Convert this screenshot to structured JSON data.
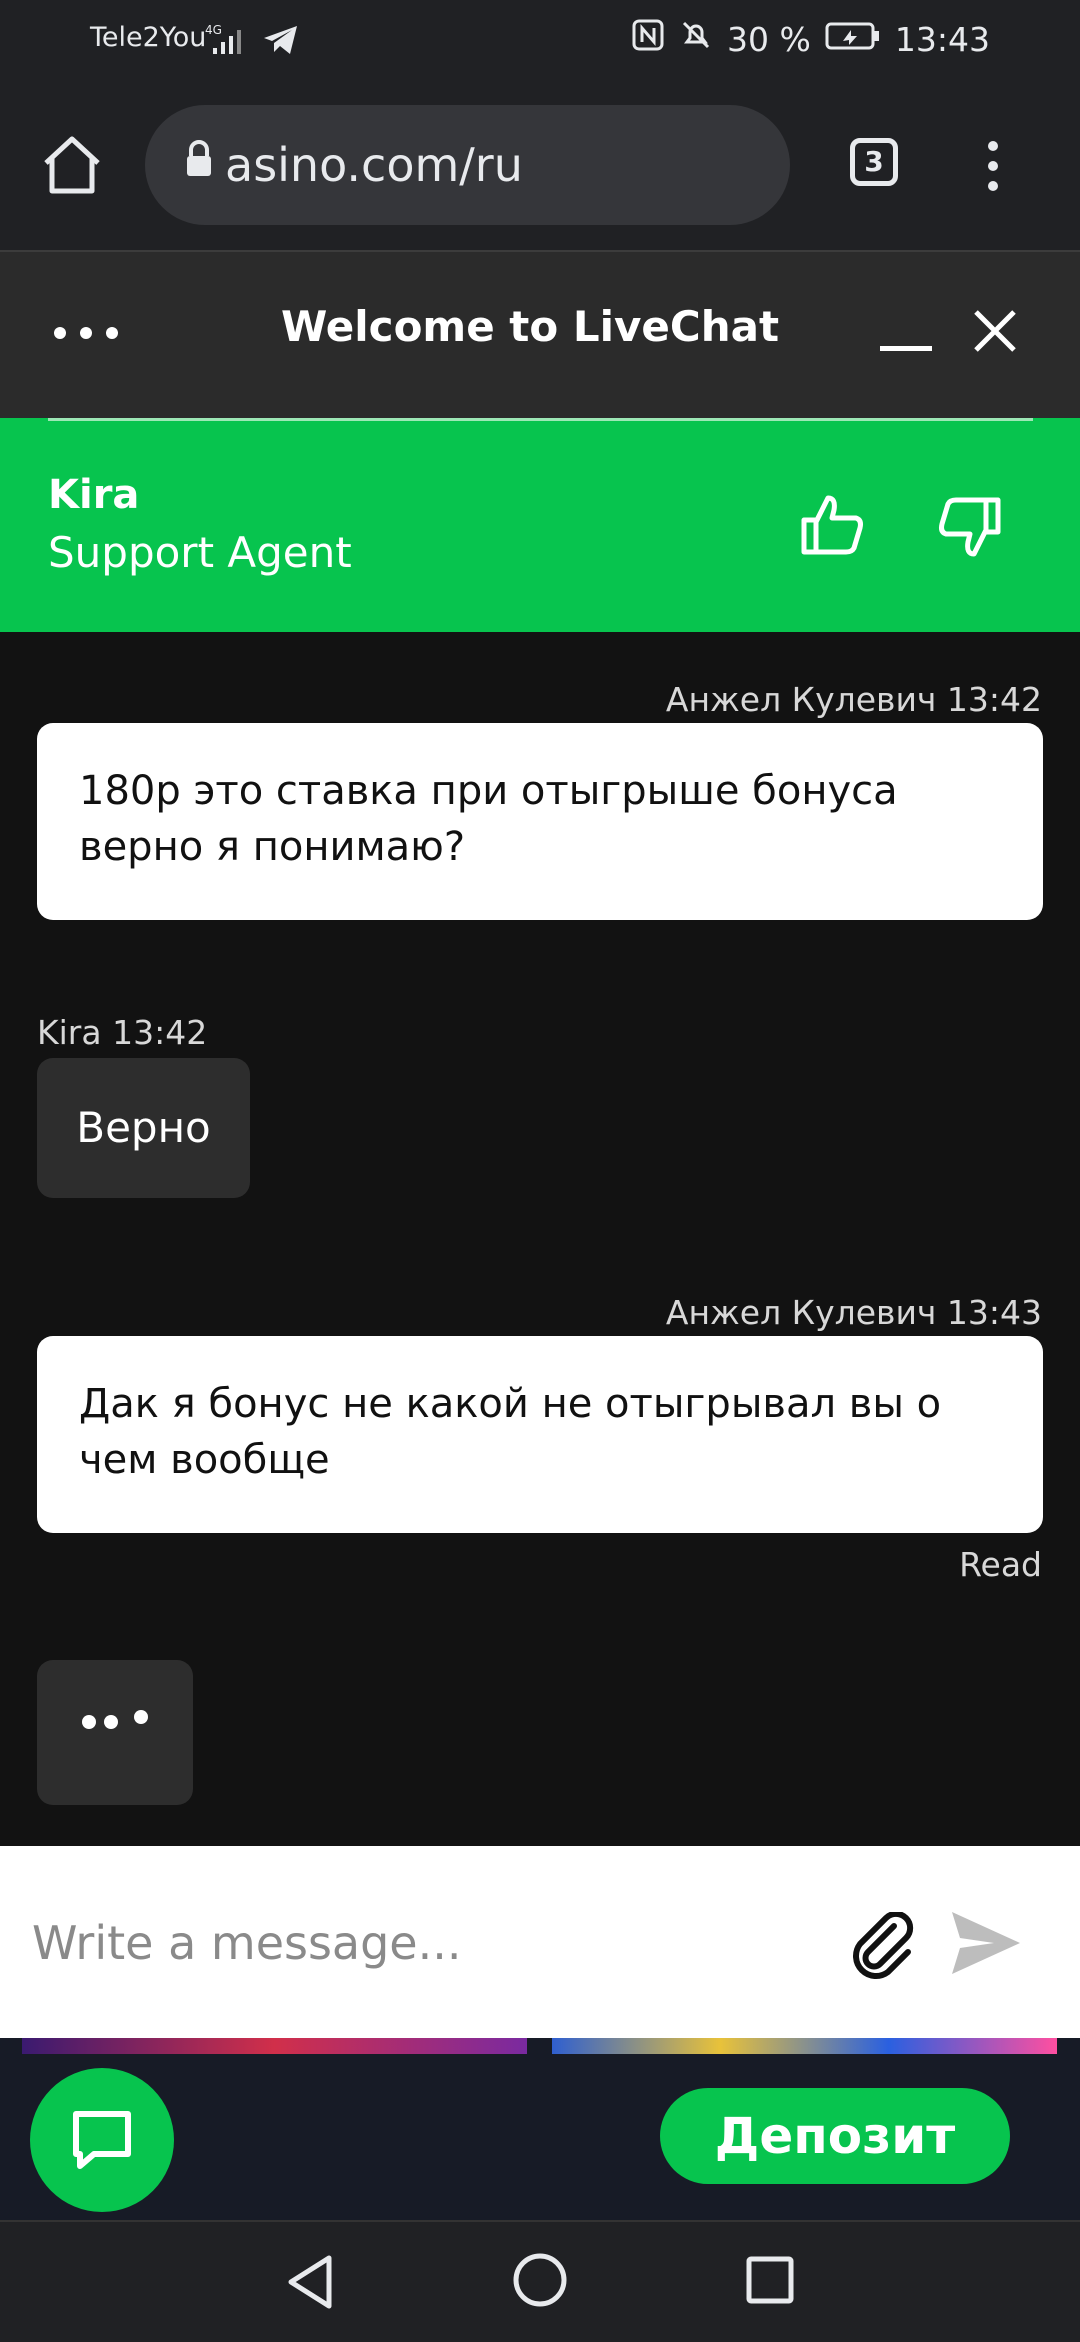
{
  "status_bar": {
    "carrier": "Tele2You",
    "battery": "30 %",
    "time": "13:43"
  },
  "browser": {
    "url": "asino.com/ru",
    "tab_count": "3"
  },
  "chat_header": {
    "title": "Welcome to LiveChat"
  },
  "agent": {
    "name": "Kira",
    "role": "Support Agent"
  },
  "messages": [
    {
      "meta": "Анжел Кулевич 13:42",
      "text": "180р это ставка при отыгрыше бонуса верно я понимаю?"
    },
    {
      "meta": "Kira 13:42",
      "text": "Верно"
    },
    {
      "meta": "Анжел Кулевич 13:43",
      "text": "Дак я бонус не какой не отыгрывал вы о чем вообще",
      "status": "Read"
    }
  ],
  "composer": {
    "placeholder": "Write a message..."
  },
  "site": {
    "deposit_label": "Депозит"
  },
  "colors": {
    "accent_green": "#07c44e",
    "header_dark": "#2b2b2b",
    "chat_bg": "#121212"
  }
}
